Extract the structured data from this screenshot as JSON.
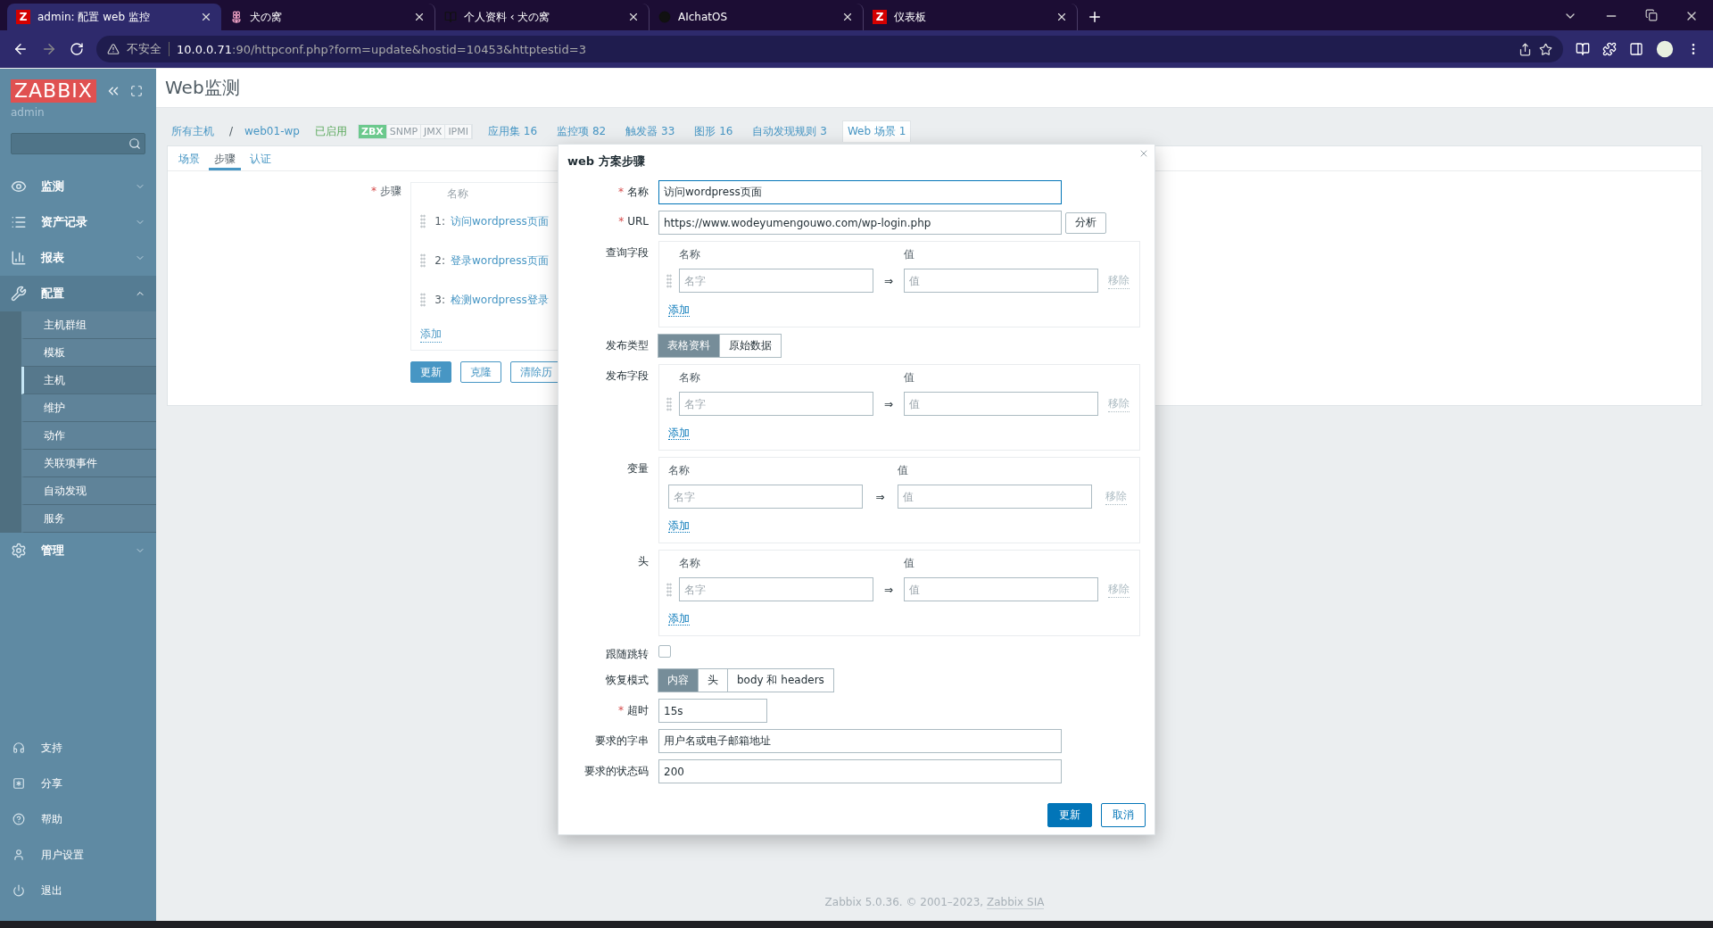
{
  "browser": {
    "tabs": [
      {
        "title": "admin: 配置 web 监控",
        "kind": "zabbix",
        "badge": "Z",
        "selected": true
      },
      {
        "title": "犬の窝",
        "kind": "flower",
        "selected": false
      },
      {
        "title": "个人资料 ‹ 犬の窝",
        "kind": "dark",
        "selected": false
      },
      {
        "title": "AIchatOS",
        "kind": "circle",
        "selected": false
      },
      {
        "title": "仪表板",
        "kind": "zabbix",
        "badge": "Z",
        "selected": false
      }
    ],
    "security": "不安全",
    "url_host": "10.0.0.71",
    "url_path": ":90/httpconf.php?form=update&hostid=10453&httptestid=3"
  },
  "sidebar": {
    "logo": "ZABBIX",
    "user": "admin",
    "menu": [
      {
        "label": "监测",
        "kind": "eye",
        "expanded": false
      },
      {
        "label": "资产记录",
        "kind": "list",
        "expanded": false
      },
      {
        "label": "报表",
        "kind": "chart",
        "expanded": false
      },
      {
        "label": "配置",
        "kind": "wrench",
        "expanded": true,
        "children": [
          {
            "label": "主机群组",
            "selected": false
          },
          {
            "label": "模板",
            "selected": false
          },
          {
            "label": "主机",
            "selected": true
          },
          {
            "label": "维护",
            "selected": false
          },
          {
            "label": "动作",
            "selected": false
          },
          {
            "label": "关联项事件",
            "selected": false
          },
          {
            "label": "自动发现",
            "selected": false
          },
          {
            "label": "服务",
            "selected": false
          }
        ]
      },
      {
        "label": "管理",
        "kind": "gear",
        "expanded": false
      }
    ],
    "bottom": [
      {
        "label": "支持",
        "kind": "headset"
      },
      {
        "label": "分享",
        "kind": "share"
      },
      {
        "label": "帮助",
        "kind": "help"
      },
      {
        "label": "用户设置",
        "kind": "user"
      },
      {
        "label": "退出",
        "kind": "power"
      }
    ]
  },
  "page": {
    "title": "Web监测",
    "breadcrumb": [
      {
        "label": "所有主机"
      },
      {
        "label": "web01-wp"
      }
    ],
    "separator": "/",
    "status": "已启用",
    "availability": [
      {
        "label": "ZBX",
        "available": true
      },
      {
        "label": "SNMP",
        "available": false
      },
      {
        "label": "JMX",
        "available": false
      },
      {
        "label": "IPMI",
        "available": false
      }
    ],
    "host_links": [
      {
        "label": "应用集",
        "count": "16",
        "selected": false
      },
      {
        "label": "监控项",
        "count": "82",
        "selected": false
      },
      {
        "label": "触发器",
        "count": "33",
        "selected": false
      },
      {
        "label": "图形",
        "count": "16",
        "selected": false
      },
      {
        "label": "自动发现规则",
        "count": "3",
        "selected": false
      },
      {
        "label": "Web 场景",
        "count": "1",
        "selected": true
      }
    ],
    "tabs": [
      {
        "label": "场景",
        "selected": false
      },
      {
        "label": "步骤",
        "selected": true
      },
      {
        "label": "认证",
        "selected": false
      }
    ],
    "steps": {
      "label": "步骤",
      "required_mark": "*",
      "header": "名称",
      "items": [
        {
          "number": "1:",
          "name": "访问wordpress页面"
        },
        {
          "number": "2:",
          "name": "登录wordpress页面"
        },
        {
          "number": "3:",
          "name": "检测wordpress登录"
        }
      ],
      "add": "添加"
    },
    "buttons": [
      {
        "label": "更新",
        "primary": true
      },
      {
        "label": "克隆",
        "primary": false
      },
      {
        "label": "清除历",
        "primary": false
      }
    ],
    "footer": "Zabbix 5.0.36. © 2001–2023, ",
    "footer_link": "Zabbix SIA"
  },
  "modal": {
    "title": "web 方案步骤",
    "fields": [
      {
        "kind": "text",
        "label": "名称",
        "required_mark": "*",
        "value": "访问wordpress页面",
        "focused": true,
        "wide": true
      },
      {
        "kind": "url",
        "label": "URL",
        "required_mark": "*",
        "value": "https://www.wodeyumengouwo.com/wp-login.php",
        "button": "分析"
      },
      {
        "kind": "pairs",
        "label": "查询字段",
        "draggable": true,
        "header_name": "名称",
        "header_value": "值",
        "rows": [
          {
            "name_placeholder": "名字",
            "arrow": "⇒",
            "value_placeholder": "值",
            "remove": "移除"
          }
        ],
        "add": "添加"
      },
      {
        "kind": "segmented",
        "label": "发布类型",
        "options": [
          {
            "label": "表格资料",
            "selected": true
          },
          {
            "label": "原始数据",
            "selected": false
          }
        ]
      },
      {
        "kind": "pairs",
        "label": "发布字段",
        "draggable": true,
        "header_name": "名称",
        "header_value": "值",
        "rows": [
          {
            "name_placeholder": "名字",
            "arrow": "⇒",
            "value_placeholder": "值",
            "remove": "移除"
          }
        ],
        "add": "添加"
      },
      {
        "kind": "pairs",
        "label": "变量",
        "draggable": false,
        "header_name": "名称",
        "header_value": "值",
        "rows": [
          {
            "name_placeholder": "名字",
            "arrow": "⇒",
            "value_placeholder": "值",
            "remove": "移除"
          }
        ],
        "add": "添加"
      },
      {
        "kind": "pairs",
        "label": "头",
        "draggable": true,
        "header_name": "名称",
        "header_value": "值",
        "rows": [
          {
            "name_placeholder": "名字",
            "arrow": "⇒",
            "value_placeholder": "值",
            "remove": "移除"
          }
        ],
        "add": "添加"
      },
      {
        "kind": "checkbox",
        "label": "跟随跳转",
        "checked": false
      },
      {
        "kind": "segmented",
        "label": "恢复模式",
        "options": [
          {
            "label": "内容",
            "selected": true
          },
          {
            "label": "头",
            "selected": false
          },
          {
            "label": "body 和 headers",
            "selected": false
          }
        ]
      },
      {
        "kind": "text",
        "label": "超时",
        "required_mark": "*",
        "value": "15s",
        "focused": false,
        "wide": false
      },
      {
        "kind": "text",
        "label": "要求的字串",
        "value": "用户名或电子邮箱地址",
        "focused": false,
        "wide": true
      },
      {
        "kind": "text",
        "label": "要求的状态码",
        "value": "200",
        "focused": false,
        "wide": true
      }
    ],
    "buttons": [
      {
        "label": "更新",
        "primary": true
      },
      {
        "label": "取消",
        "primary": false
      }
    ]
  }
}
